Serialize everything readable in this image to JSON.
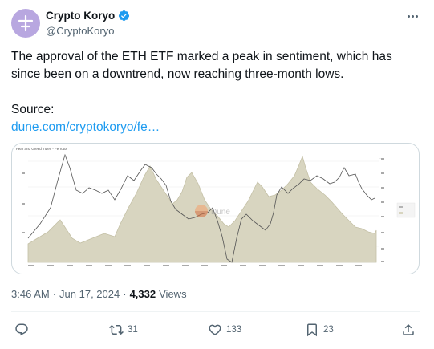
{
  "author": {
    "name": "Crypto Koryo",
    "handle": "@CryptoKoryo",
    "avatar_glyph": "士",
    "verified": true
  },
  "tweet": {
    "line1": "The approval of the ETH ETF marked a peak in sentiment, which has since been on a downtrend, now reaching three-month lows.",
    "source_label": "Source:",
    "link_text": "dune.com/cryptokoryo/fe…"
  },
  "media": {
    "watermark": "Dune",
    "chart_title": "Fear and Greed Index - Ferrutor"
  },
  "meta": {
    "time": "3:46 AM",
    "separator": "·",
    "date": "Jun 17, 2024",
    "views_count": "4,332",
    "views_label": "Views"
  },
  "actions": {
    "reply_count": "",
    "retweet_count": "31",
    "like_count": "133",
    "bookmark_count": "23"
  },
  "colors": {
    "accent": "#1d9bf0",
    "text": "#0f1419",
    "muted": "#536471",
    "area_fill": "#d7d4bf",
    "area_stroke": "#bdb99f"
  }
}
